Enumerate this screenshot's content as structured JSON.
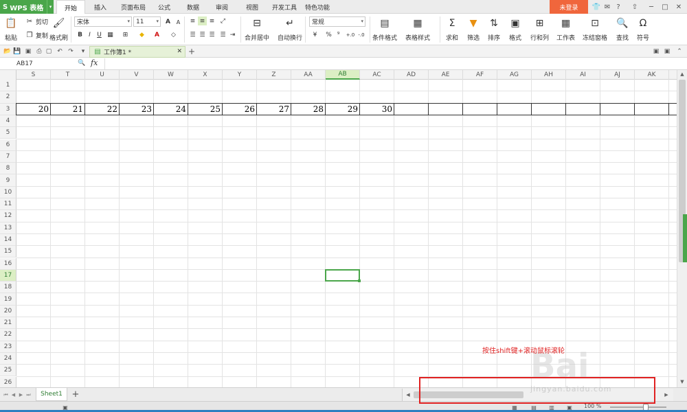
{
  "app": {
    "logo": "S",
    "name": "WPS 表格",
    "login": "未登录"
  },
  "menu": [
    "开始",
    "插入",
    "页面布局",
    "公式",
    "数据",
    "审阅",
    "视图",
    "开发工具",
    "特色功能"
  ],
  "ribbon": {
    "paste": "粘贴",
    "cut": "剪切",
    "copy": "复制",
    "format_painter": "格式刷",
    "font_name": "宋体",
    "font_size": "11",
    "merge_center": "合并居中",
    "wrap_text": "自动换行",
    "number_format": "常规",
    "cond_format": "条件格式",
    "table_style": "表格样式",
    "sum": "求和",
    "filter": "筛选",
    "sort": "排序",
    "format": "格式",
    "rows_cols": "行和列",
    "worksheet": "工作表",
    "freeze": "冻结窗格",
    "find": "查找",
    "symbol": "符号",
    "bold": "B",
    "italic": "I",
    "underline": "U",
    "font_grow": "A",
    "font_shrink": "A",
    "percent": "%",
    "comma": "⁹",
    "dec_inc": "+.0",
    "dec_dec": "-.0"
  },
  "doc_tab": "工作簿1 *",
  "namebox": "AB17",
  "fx": "fx",
  "columns": [
    "S",
    "T",
    "U",
    "V",
    "W",
    "X",
    "Y",
    "Z",
    "AA",
    "AB",
    "AC",
    "AD",
    "AE",
    "AF",
    "AG",
    "AH",
    "AI",
    "AJ",
    "AK"
  ],
  "selected_column": "AB",
  "rows": [
    "1",
    "2",
    "3",
    "4",
    "5",
    "6",
    "7",
    "8",
    "9",
    "10",
    "11",
    "12",
    "13",
    "14",
    "15",
    "16",
    "17",
    "18",
    "19",
    "20",
    "21",
    "22",
    "23",
    "24",
    "25",
    "26"
  ],
  "selected_row": "17",
  "row3_values": [
    "20",
    "21",
    "22",
    "23",
    "24",
    "25",
    "26",
    "27",
    "28",
    "29",
    "30"
  ],
  "sheet_tab": "Sheet1",
  "status": {
    "zoom": "100 %"
  },
  "annotation": {
    "hint": "按住shift键+滚动鼠标滚轮"
  },
  "watermark": {
    "main": "Bai",
    "sub": "jingyan.baidu.com"
  },
  "colors": {
    "accent": "#4aa64a",
    "login": "#f0663c",
    "annotation": "#e02020"
  }
}
